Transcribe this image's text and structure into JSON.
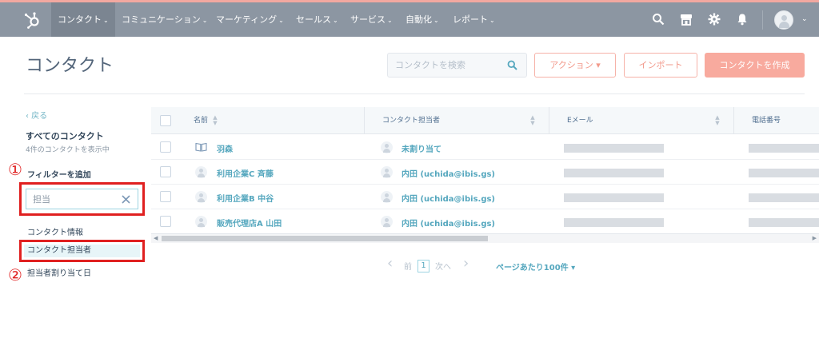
{
  "nav": {
    "items": [
      {
        "label": "コンタクト",
        "active": true
      },
      {
        "label": "コミュニケーション",
        "active": false
      },
      {
        "label": "マーケティング",
        "active": false
      },
      {
        "label": "セールス",
        "active": false
      },
      {
        "label": "サービス",
        "active": false
      },
      {
        "label": "自動化",
        "active": false
      },
      {
        "label": "レポート",
        "active": false
      }
    ],
    "chevron": "⌄",
    "icons": [
      "search-icon",
      "marketplace-icon",
      "settings-icon",
      "notifications-icon",
      "avatar"
    ]
  },
  "header": {
    "title": "コンタクト",
    "search_placeholder": "コンタクトを検索",
    "actions_label": "アクション ▾",
    "import_label": "インポート",
    "create_label": "コンタクトを作成"
  },
  "sidebar": {
    "back_label": "‹ 戻る",
    "view_title": "すべてのコンタクト",
    "view_subtitle": "4件のコンタクトを表示中",
    "filter_heading": "フィルターを追加",
    "filter_value": "担当",
    "group_label": "コンタクト情報",
    "properties": [
      "コンタクト担当者",
      "担当者割り当て日"
    ]
  },
  "annotations": [
    "①",
    "②"
  ],
  "table": {
    "columns": [
      "名前",
      "コンタクト担当者",
      "Eメール",
      "電話番号"
    ],
    "rows": [
      {
        "name": "羽森",
        "owner": "未割り当て",
        "name_icon": "book-icon"
      },
      {
        "name": "利用企業C 斉藤",
        "owner": "内田 (uchida@ibis.gs)",
        "name_icon": "avatar"
      },
      {
        "name": "利用企業B 中谷",
        "owner": "内田 (uchida@ibis.gs)",
        "name_icon": "avatar"
      },
      {
        "name": "販売代理店A 山田",
        "owner": "内田 (uchida@ibis.gs)",
        "name_icon": "avatar"
      }
    ]
  },
  "pagination": {
    "prev_label": "前",
    "current_page": "1",
    "next_label": "次へ",
    "per_page_label": "ページあたり100件 ▾"
  },
  "colors": {
    "nav_bg": "#8c96a2",
    "accent": "#f8aa9e",
    "link": "#55a7be",
    "annotation": "#e02020"
  }
}
